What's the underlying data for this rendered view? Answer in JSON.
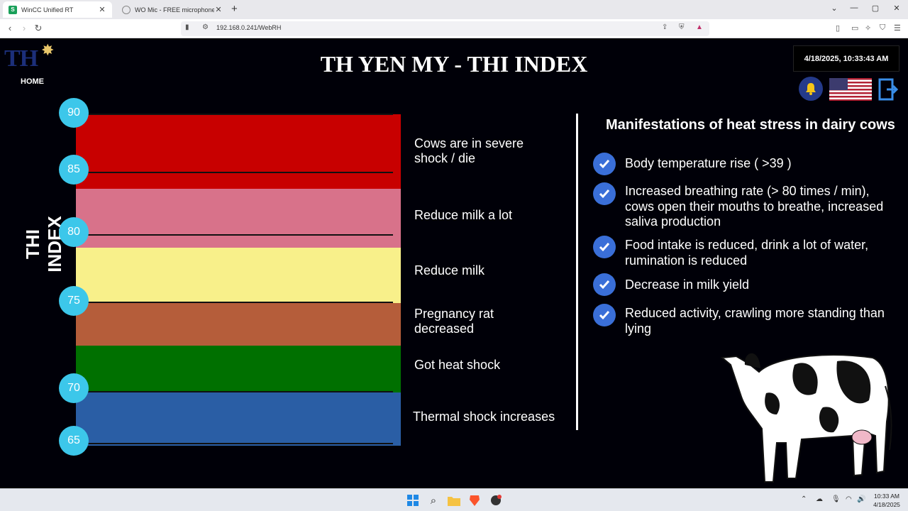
{
  "browser": {
    "tabs": [
      {
        "title": "WinCC Unified RT",
        "favicon": "S",
        "active": true
      },
      {
        "title": "WO Mic - FREE microphone",
        "active": false
      }
    ],
    "url": "192.168.0.241/WebRH"
  },
  "header": {
    "logo_text": "TH",
    "home_label": "HOME",
    "title": "TH YEN MY - THI INDEX",
    "datetime": "4/18/2025, 10:33:43 AM"
  },
  "chart": {
    "axis_label": "THI INDEX",
    "bubbles": [
      "90",
      "85",
      "80",
      "75",
      "70",
      "65"
    ],
    "zones": [
      {
        "color": "#c80000",
        "text": "Cows are in severe shock / die"
      },
      {
        "color": "#d8728a",
        "text": "Reduce milk a lot"
      },
      {
        "color": "#f8f08a",
        "text": "Reduce milk"
      },
      {
        "color": "#b55d3a",
        "text": "Pregnancy rat decreased"
      },
      {
        "color": "#007000",
        "text": "Got heat shock"
      },
      {
        "color": "#2a5ea5",
        "text": "Thermal shock increases"
      }
    ]
  },
  "manifestations": {
    "title": "Manifestations of heat stress in dairy cows",
    "items": [
      "Body temperature rise ( >39 )",
      "Increased breathing rate (> 80 times / min), cows open their mouths to breathe, increased saliva production",
      "Food intake is reduced, drink a lot of water, rumination is reduced",
      "Decrease in milk yield",
      "Reduced activity, crawling more standing than lying"
    ]
  },
  "taskbar": {
    "time": "10:33 AM",
    "date": "4/18/2025"
  }
}
